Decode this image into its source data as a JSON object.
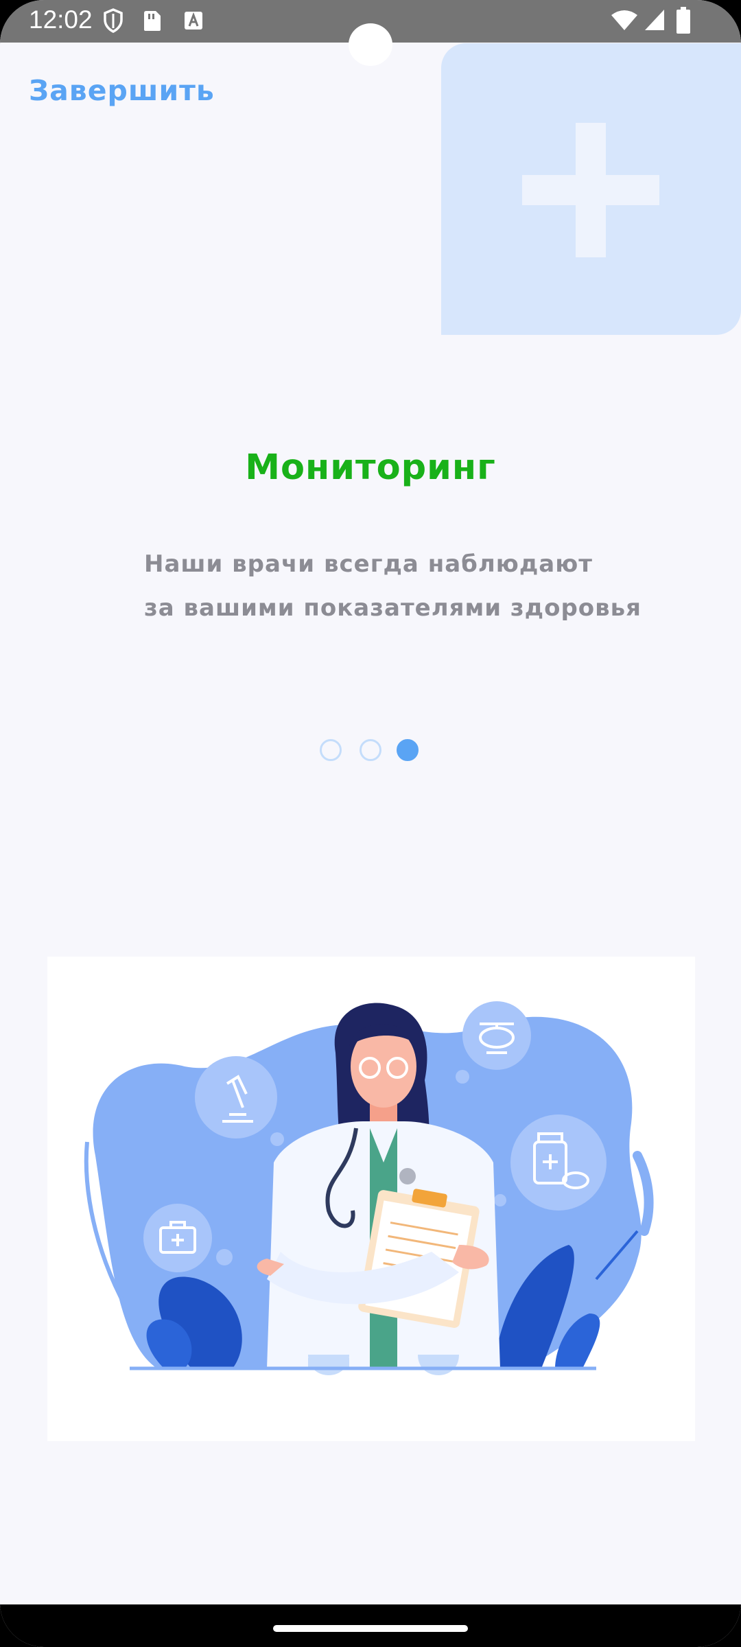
{
  "status_bar": {
    "time": "12:02",
    "left_icons": [
      "shield-icon",
      "sim-card-icon",
      "font-a-icon"
    ],
    "right_icons": [
      "wifi-icon",
      "signal-icon",
      "battery-icon"
    ]
  },
  "header": {
    "finish_label": "Завершить"
  },
  "onboarding": {
    "title": "Мониторинг",
    "subtitle_line1": "Наши врачи всегда наблюдают",
    "subtitle_line2": "за вашими показателями здоровья",
    "page_count": 3,
    "current_page": 3
  },
  "colors": {
    "accent": "#5aa4f4",
    "title_green": "#19b119",
    "subtitle_gray": "#8c8c94",
    "background": "#f7f7fc",
    "deco_card": "#d7e6fc"
  },
  "illustration": {
    "icon": "doctor-illustration"
  }
}
